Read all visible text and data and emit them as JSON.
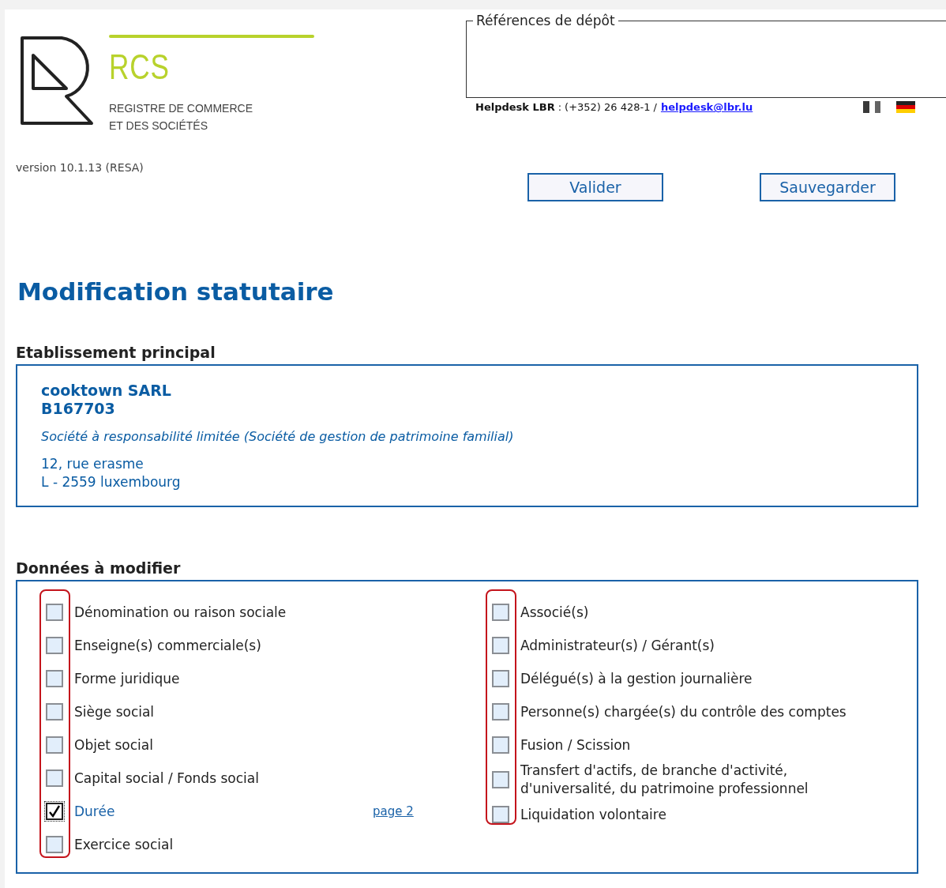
{
  "logo": {
    "name": "RCS",
    "subtitle_lines": [
      "REGISTRE DE COMMERCE",
      "ET DES SOCIÉTÉS"
    ]
  },
  "version": "version 10.1.13 (RESA)",
  "references": {
    "legend": "Références de dépôt"
  },
  "helpdesk": {
    "label": "Helpdesk LBR",
    "separator": ":",
    "phone": "(+352) 26 428-1",
    "slash": "/",
    "email": "helpdesk@lbr.lu"
  },
  "languages": [
    {
      "kind": "french",
      "selected": true
    },
    {
      "kind": "german",
      "selected": false
    }
  ],
  "buttons": [
    "Valider",
    "Sauvegarder"
  ],
  "title": "Modification statutaire",
  "establishment": {
    "heading": "Etablissement principal",
    "name": "cooktown SARL",
    "number": "B167703",
    "legal_form": "Société à responsabilité limitée (Société de gestion de patrimoine familial)",
    "address_lines": [
      "12, rue erasme",
      "L - 2559 luxembourg"
    ]
  },
  "changes": {
    "heading": "Données à modifier",
    "columns": [
      [
        {
          "label": "Dénomination ou raison sociale",
          "checked": false
        },
        {
          "label": "Enseigne(s) commerciale(s)",
          "checked": false
        },
        {
          "label": "Forme juridique",
          "checked": false
        },
        {
          "label": "Siège social",
          "checked": false
        },
        {
          "label": "Objet social",
          "checked": false
        },
        {
          "label": "Capital social / Fonds social",
          "checked": false
        },
        {
          "label": "Durée",
          "checked": true,
          "link": "page 2"
        },
        {
          "label": "Exercice social",
          "checked": false
        }
      ],
      [
        {
          "label": "Associé(s)",
          "checked": false
        },
        {
          "label": "Administrateur(s) / Gérant(s)",
          "checked": false
        },
        {
          "label": "Délégué(s) à la gestion journalière",
          "checked": false
        },
        {
          "label": "Personne(s) chargée(s) du contrôle des comptes",
          "checked": false
        },
        {
          "label": "Fusion / Scission",
          "checked": false
        },
        {
          "label": "Transfert d'actifs, de branche d'activité, d'universalité, du patrimoine professionnel",
          "checked": false
        },
        {
          "label": "Liquidation volontaire",
          "checked": false
        }
      ]
    ]
  }
}
